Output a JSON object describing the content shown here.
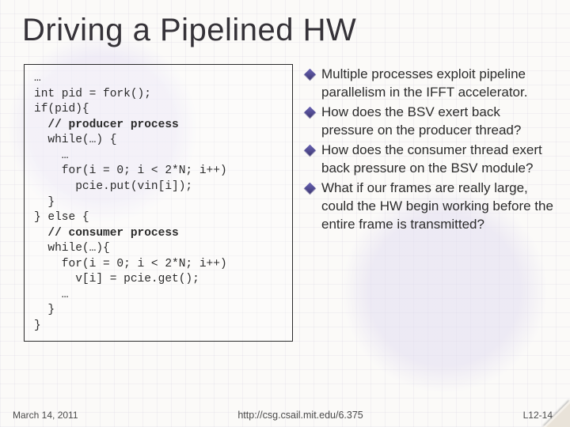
{
  "title": "Driving a Pipelined HW",
  "code": {
    "l0": "…",
    "l1": "int pid = fork();",
    "l2": "if(pid){",
    "l3": "  // producer process",
    "l4": "  while(…) {",
    "l5": "    …",
    "l6": "    for(i = 0; i < 2*N; i++)",
    "l7": "      pcie.put(vin[i]);",
    "l8": "  }",
    "l9": "} else {",
    "l10": "  // consumer process",
    "l11": "  while(…){",
    "l12": "    for(i = 0; i < 2*N; i++)",
    "l13": "      v[i] = pcie.get();",
    "l14": "    …",
    "l15": "  }",
    "l16": "}"
  },
  "bullets": [
    "Multiple processes exploit pipeline parallelism in the IFFT accelerator.",
    "How does the BSV exert back pressure on the producer thread?",
    "How does the consumer thread exert back pressure on the BSV module?",
    "What if our frames are really large, could the HW begin working before the entire frame is transmitted?"
  ],
  "footer": {
    "date": "March 14, 2011",
    "url": "http://csg.csail.mit.edu/6.375",
    "page": "L12-14"
  }
}
